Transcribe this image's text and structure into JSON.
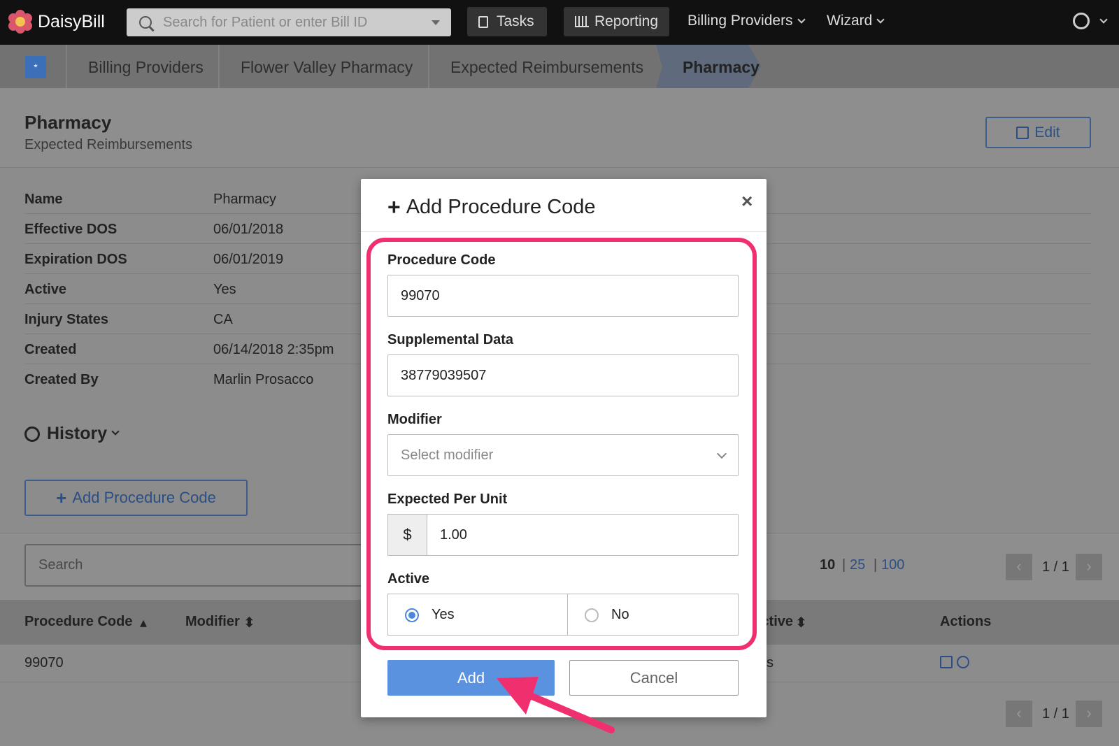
{
  "app": {
    "name": "DaisyBill"
  },
  "nav": {
    "search_placeholder": "Search for Patient or enter Bill ID",
    "tasks": "Tasks",
    "reporting": "Reporting",
    "billing_providers": "Billing Providers",
    "wizard": "Wizard"
  },
  "breadcrumb": [
    "Billing Providers",
    "Flower Valley Pharmacy",
    "Expected Reimbursements",
    "Pharmacy"
  ],
  "page": {
    "title": "Pharmacy",
    "subtitle": "Expected Reimbursements",
    "edit_label": "Edit"
  },
  "details": [
    {
      "label": "Name",
      "value": "Pharmacy"
    },
    {
      "label": "Effective DOS",
      "value": "06/01/2018"
    },
    {
      "label": "Expiration DOS",
      "value": "06/01/2019"
    },
    {
      "label": "Active",
      "value": "Yes"
    },
    {
      "label": "Injury States",
      "value": "CA"
    },
    {
      "label": "Created",
      "value": "06/14/2018 2:35pm"
    },
    {
      "label": "Created By",
      "value": "Marlin Prosacco"
    }
  ],
  "history_label": "History",
  "add_procedure_label": "Add Procedure Code",
  "list": {
    "search_placeholder": "Search",
    "page_sizes": [
      "10",
      "25",
      "100"
    ],
    "pager": "1 / 1",
    "columns": [
      "Procedure Code",
      "Modifier",
      "Active",
      "Actions"
    ],
    "rows": [
      {
        "procedure_code": "99070",
        "active_fragment": "s"
      }
    ]
  },
  "modal": {
    "title": "Add Procedure Code",
    "procedure_code_label": "Procedure Code",
    "procedure_code_value": "99070",
    "supplemental_label": "Supplemental Data",
    "supplemental_value": "38779039507",
    "modifier_label": "Modifier",
    "modifier_placeholder": "Select modifier",
    "expected_label": "Expected Per Unit",
    "currency_symbol": "$",
    "expected_value": "1.00",
    "active_label": "Active",
    "yes": "Yes",
    "no": "No",
    "add": "Add",
    "cancel": "Cancel"
  },
  "colors": {
    "accent": "#5b92e0",
    "highlight": "#f0306e",
    "link": "#2c4e82"
  }
}
